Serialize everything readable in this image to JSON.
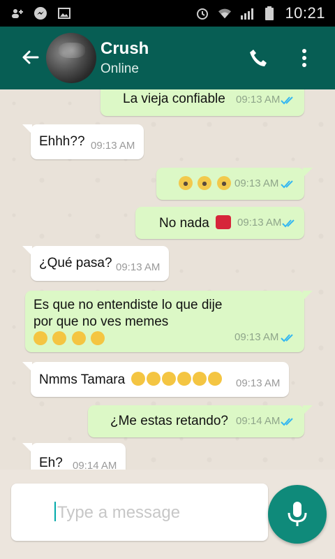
{
  "status_bar": {
    "time": "10:21"
  },
  "header": {
    "title": "Crush",
    "subtitle": "Online"
  },
  "messages": [
    {
      "text": "La vieja confiable",
      "time": "09:13 AM",
      "direction": "out"
    },
    {
      "text": "Ehhh??",
      "time": "09:13 AM",
      "direction": "in"
    },
    {
      "text": "",
      "time": "09:13 AM",
      "direction": "out",
      "emoji": [
        "scream",
        "scream",
        "scream"
      ]
    },
    {
      "text": "No nada",
      "time": "09:13 AM",
      "direction": "out",
      "emoji": [
        "broken-heart"
      ]
    },
    {
      "text": "¿Qué pasa?",
      "time": "09:13 AM",
      "direction": "in"
    },
    {
      "text_line1": "Es que no entendiste lo que dije",
      "text_line2": "por que no ves memes",
      "time": "09:13 AM",
      "direction": "out",
      "emoji": [
        "pensive",
        "pensive",
        "pensive",
        "pensive"
      ]
    },
    {
      "text": "Nmms Tamara",
      "time": "09:13 AM",
      "direction": "in",
      "emoji": [
        "unamused",
        "unamused",
        "unamused",
        "unamused",
        "unamused",
        "unamused"
      ]
    },
    {
      "text": "¿Me estas retando?",
      "time": "09:14 AM",
      "direction": "out"
    },
    {
      "text": "Eh?",
      "time": "09:14 AM",
      "direction": "in"
    }
  ],
  "composer": {
    "placeholder": "Type a message"
  },
  "colors": {
    "header": "#075e54",
    "outgoing": "#dcf8c6",
    "incoming": "#ffffff",
    "tick": "#34b7f1",
    "fab": "#0f8a7a"
  }
}
